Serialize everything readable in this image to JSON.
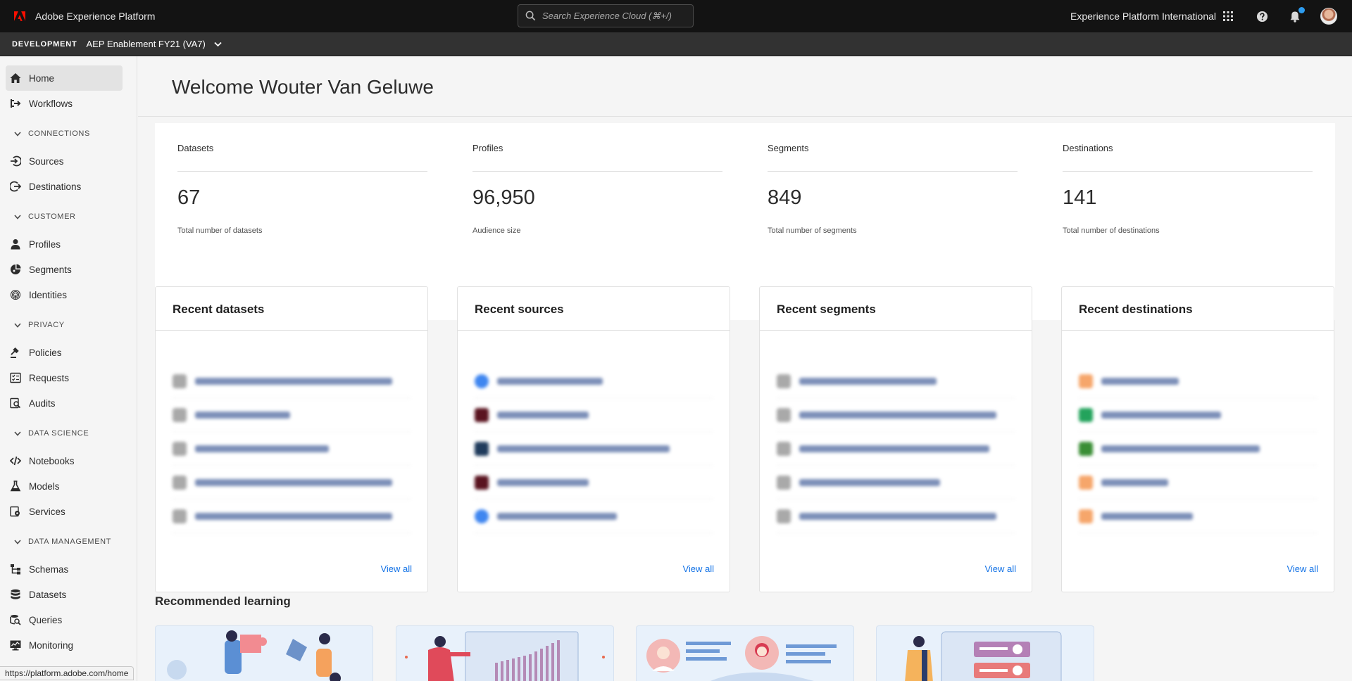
{
  "app": {
    "name": "Adobe Experience Platform"
  },
  "search": {
    "placeholder": "Search Experience Cloud (⌘+/)"
  },
  "header": {
    "org": "Experience Platform International",
    "icons": [
      "apps-grid-icon",
      "help-icon",
      "notification-bell-icon",
      "user-avatar"
    ],
    "accent": "#2d9cf0"
  },
  "sandbox": {
    "environment": "DEVELOPMENT",
    "name": "AEP Enablement FY21 (VA7)"
  },
  "sidebar": {
    "home": "Home",
    "workflows": "Workflows",
    "sections": {
      "connections": {
        "label": "CONNECTIONS",
        "items": [
          "Sources",
          "Destinations"
        ]
      },
      "customer": {
        "label": "CUSTOMER",
        "items": [
          "Profiles",
          "Segments",
          "Identities"
        ]
      },
      "privacy": {
        "label": "PRIVACY",
        "items": [
          "Policies",
          "Requests",
          "Audits"
        ]
      },
      "data_science": {
        "label": "DATA SCIENCE",
        "items": [
          "Notebooks",
          "Models",
          "Services"
        ]
      },
      "data_management": {
        "label": "DATA MANAGEMENT",
        "items": [
          "Schemas",
          "Datasets",
          "Queries",
          "Monitoring"
        ]
      }
    }
  },
  "main": {
    "welcome": "Welcome Wouter Van Geluwe",
    "stats": [
      {
        "title": "Datasets",
        "value": "67",
        "caption": "Total number of datasets"
      },
      {
        "title": "Profiles",
        "value": "96,950",
        "caption": "Audience size"
      },
      {
        "title": "Segments",
        "value": "849",
        "caption": "Total number of segments"
      },
      {
        "title": "Destinations",
        "value": "141",
        "caption": "Total number of destinations"
      }
    ],
    "cards": [
      {
        "title": "Recent datasets",
        "link": "View all"
      },
      {
        "title": "Recent sources",
        "link": "View all"
      },
      {
        "title": "Recent segments",
        "link": "View all"
      },
      {
        "title": "Recent destinations",
        "link": "View all"
      }
    ],
    "learning_title": "Recommended learning"
  },
  "status_bar": {
    "url": "https://platform.adobe.com/home"
  }
}
